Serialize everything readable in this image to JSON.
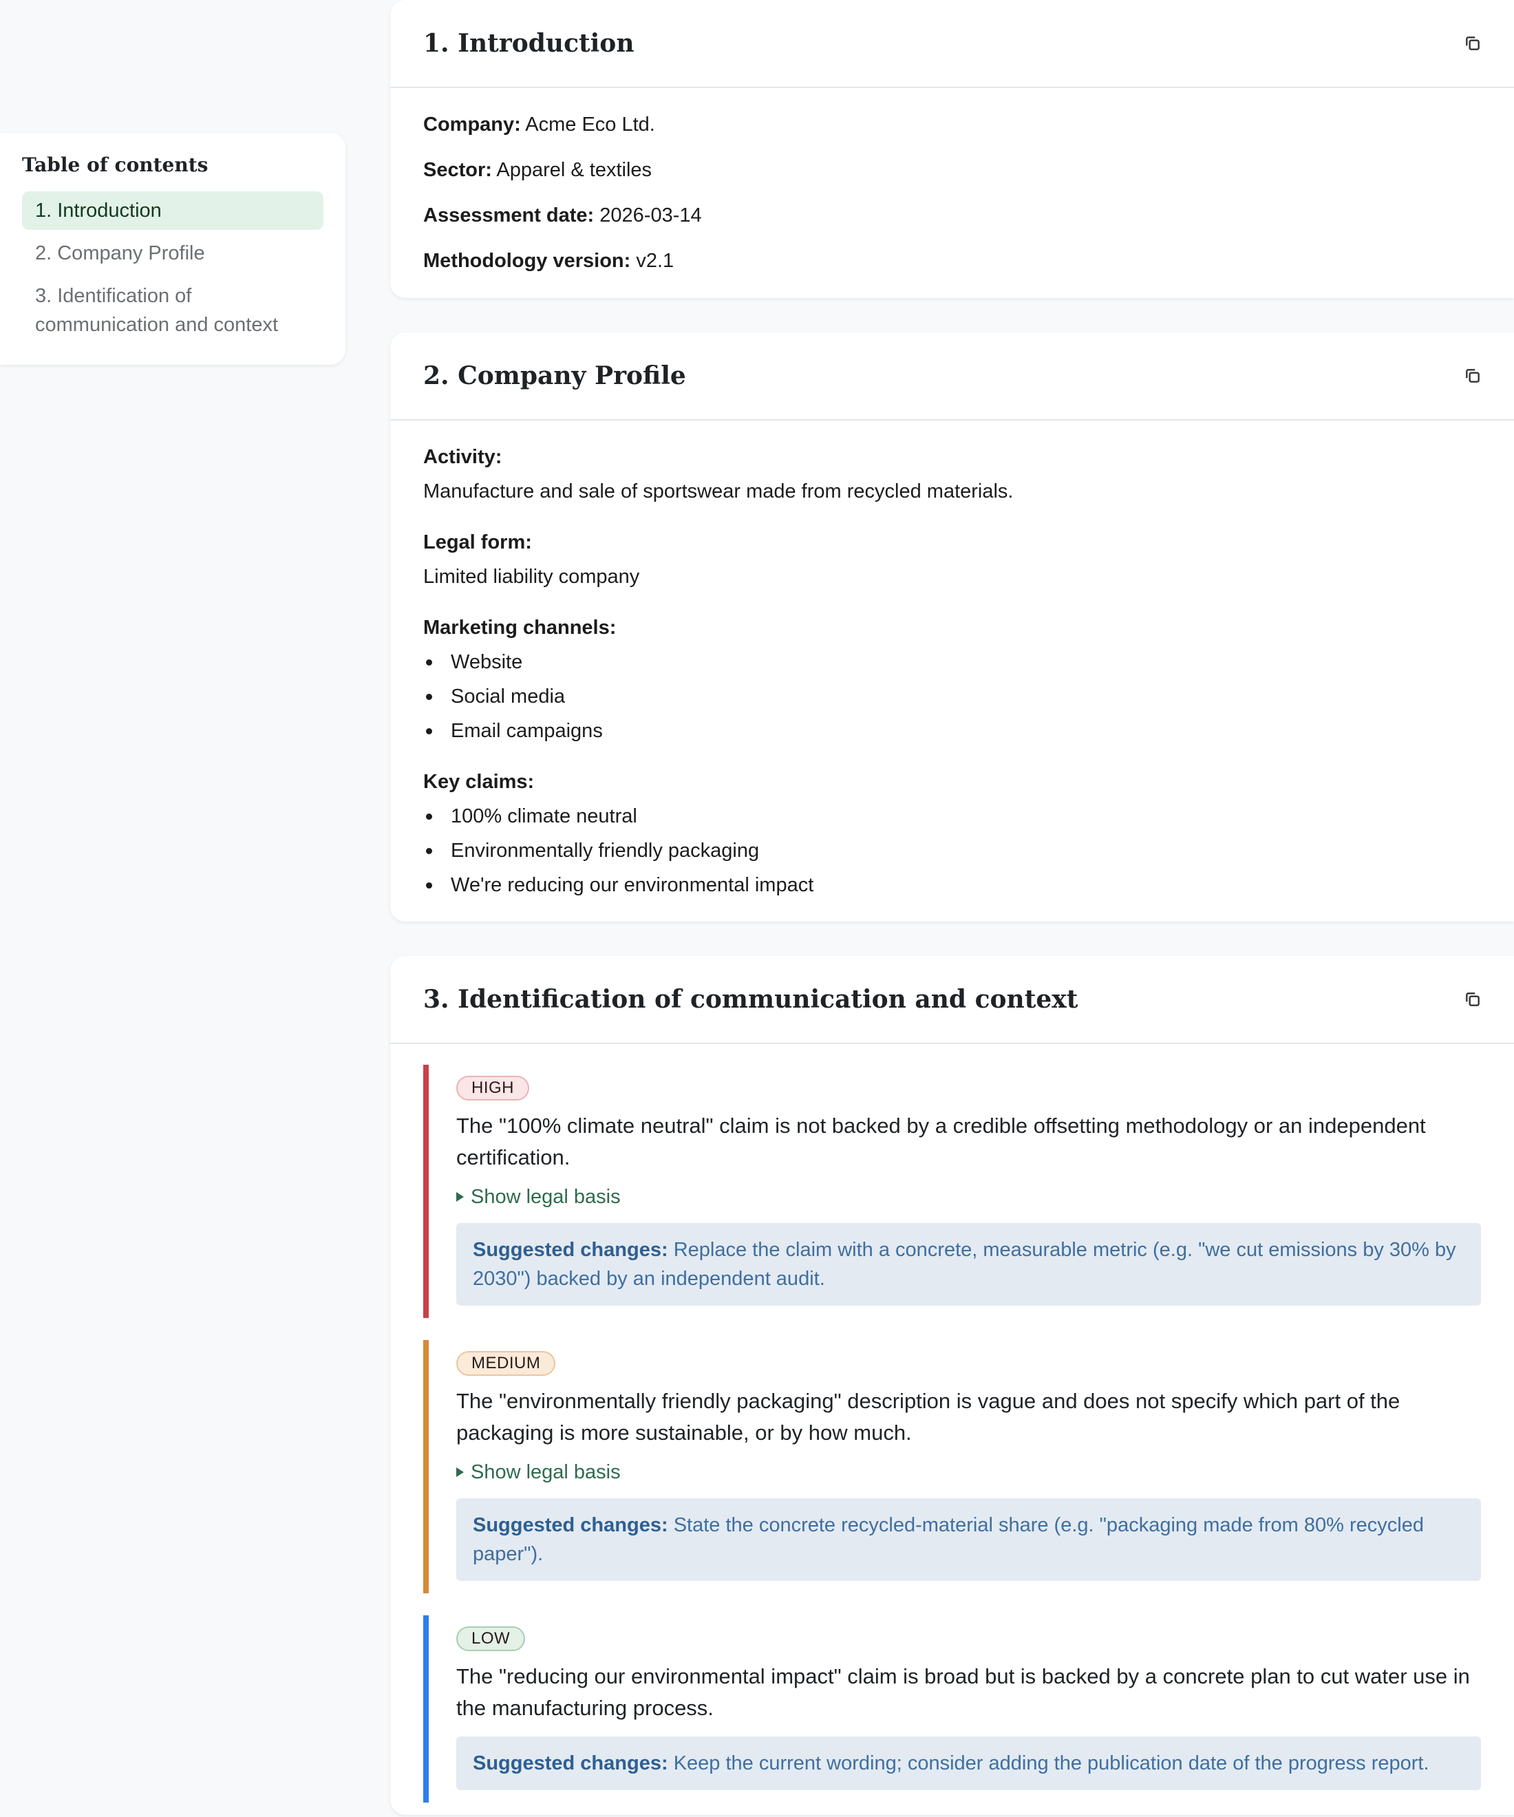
{
  "toc": {
    "title": "Table of contents",
    "items": [
      {
        "label": "1. Introduction",
        "active": true
      },
      {
        "label": "2. Company Profile",
        "active": false
      },
      {
        "label": "3. Identification of communication and context",
        "active": false
      }
    ]
  },
  "intro": {
    "title": "1. Introduction",
    "fields": [
      {
        "label": "Company:",
        "value": "Acme Eco Ltd."
      },
      {
        "label": "Sector:",
        "value": "Apparel & textiles"
      },
      {
        "label": "Assessment date:",
        "value": "2026-03-14"
      },
      {
        "label": "Methodology version:",
        "value": "v2.1"
      }
    ]
  },
  "profile": {
    "title": "2. Company Profile",
    "activity_label": "Activity:",
    "activity_value": "Manufacture and sale of sportswear made from recycled materials.",
    "legal_label": "Legal form:",
    "legal_value": "Limited liability company",
    "channels_label": "Marketing channels:",
    "channels": [
      "Website",
      "Social media",
      "Email campaigns"
    ],
    "claims_label": "Key claims:",
    "claims": [
      "100% climate neutral",
      "Environmentally friendly packaging",
      "We're reducing our environmental impact"
    ]
  },
  "identification": {
    "title": "3. Identification of communication and context",
    "suggest_label": "Suggested changes:",
    "legal_toggle": "Show legal basis",
    "findings": [
      {
        "level": "HIGH",
        "text": "The \"100% climate neutral\" claim is not backed by a credible offsetting methodology or an independent certification.",
        "suggestion": "Replace the claim with a concrete, measurable metric (e.g. \"we cut emissions by 30% by 2030\") backed by an independent audit."
      },
      {
        "level": "MEDIUM",
        "text": "The \"environmentally friendly packaging\" description is vague and does not specify which part of the packaging is more sustainable, or by how much.",
        "suggestion": "State the concrete recycled-material share (e.g. \"packaging made from 80% recycled paper\")."
      },
      {
        "level": "LOW",
        "text": "The \"reducing our environmental impact\" claim is broad but is backed by a concrete plan to cut water use in the manufacturing process.",
        "suggestion": "Keep the current wording; consider adding the publication date of the progress report."
      }
    ]
  },
  "icons": {
    "copy": "copy-icon"
  },
  "colors": {
    "high": "#c8414a",
    "medium": "#d6893a",
    "low": "#2f7ee8",
    "accent": "#2f6b4d"
  }
}
